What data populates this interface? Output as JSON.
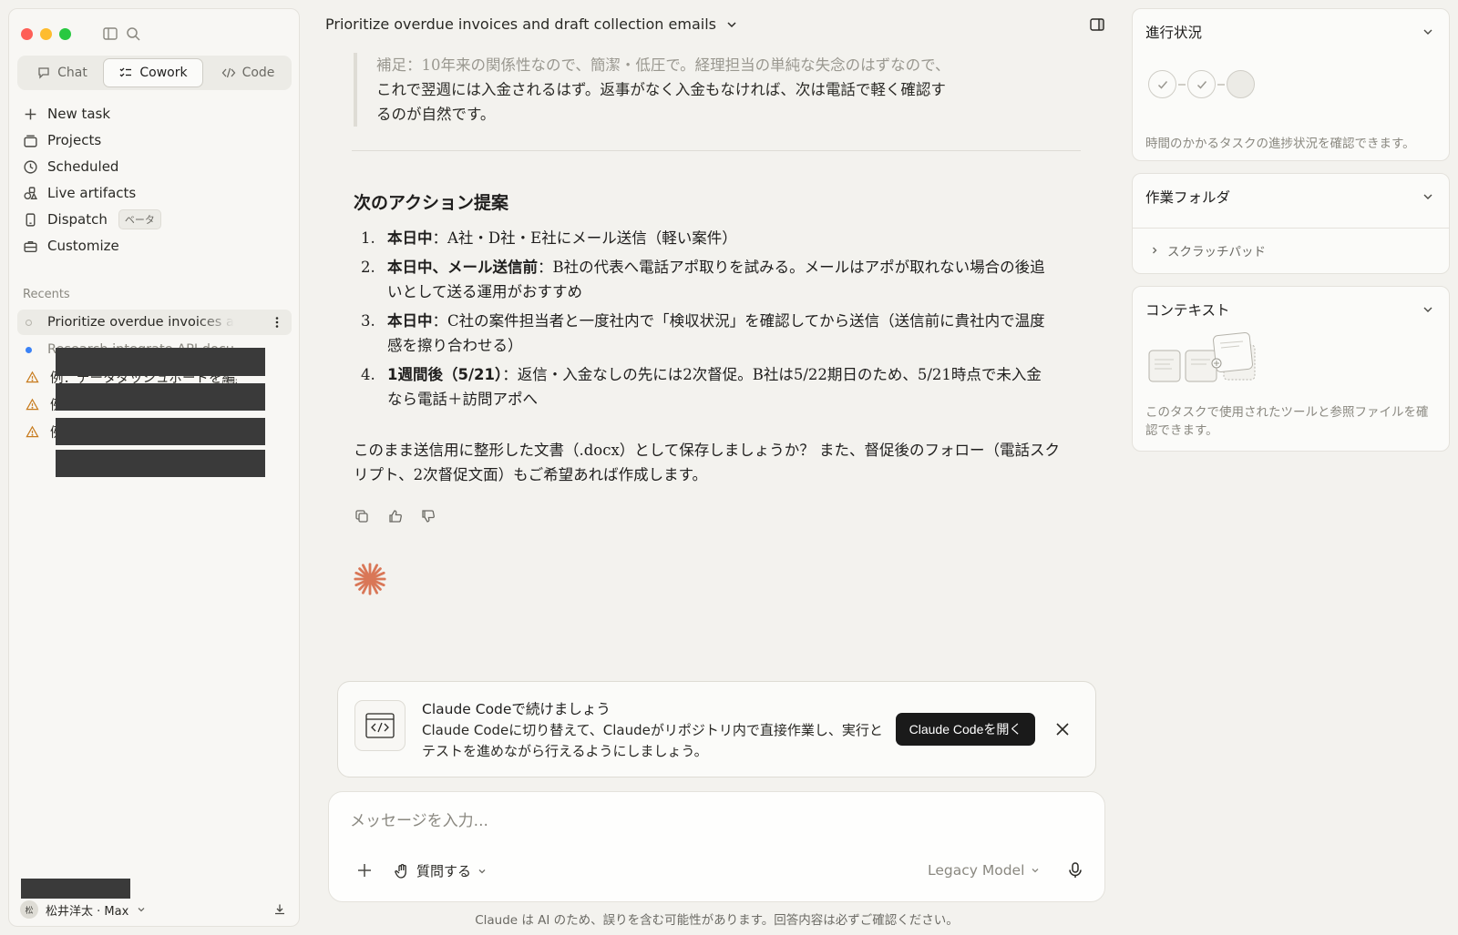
{
  "sidebar": {
    "modes": [
      {
        "label": "Chat",
        "icon": "chat-bubble-icon",
        "active": false
      },
      {
        "label": "Cowork",
        "icon": "checklist-icon",
        "active": true
      },
      {
        "label": "Code",
        "icon": "code-brackets-icon",
        "active": false
      }
    ],
    "nav": {
      "new_task": "New task",
      "projects": "Projects",
      "scheduled": "Scheduled",
      "live_artifacts": "Live artifacts",
      "dispatch": "Dispatch",
      "dispatch_badge": "ベータ",
      "customize": "Customize"
    },
    "recents_label": "Recents",
    "recents": [
      {
        "title": "Prioritize overdue invoices and draft collection emails",
        "status": "active"
      },
      {
        "title": "Research integrate API documentation",
        "status": "blue-dot"
      },
      {
        "title": "例：データダッシュボードを編集",
        "status": "warning"
      },
      {
        "title": "例：",
        "status": "warning"
      },
      {
        "title": "例：",
        "status": "warning"
      }
    ],
    "user": {
      "avatar_initial": "松",
      "name": "松井洋太 · Max"
    }
  },
  "header": {
    "title": "Prioritize overdue invoices and draft collection emails"
  },
  "message": {
    "quote_line1": "補足：10年来の関係性なので、簡潔・低圧で。経理担当の単純な失念のはずなので、",
    "quote_line2": "これで翌週には入金されるはず。返事がなく入金もなければ、次は電話で軽く確認す",
    "quote_line3": "るのが自然です。",
    "heading": "次のアクション提案",
    "actions": [
      {
        "num": "1.",
        "bold": "本日中",
        "text": "：A社・D社・E社にメール送信（軽い案件）"
      },
      {
        "num": "2.",
        "bold": "本日中、メール送信前",
        "text": "：B社の代表へ電話アポ取りを試みる。メールはアポが取れない場合の後追いとして送る運用がおすすめ"
      },
      {
        "num": "3.",
        "bold": "本日中",
        "text": "：C社の案件担当者と一度社内で「検収状況」を確認してから送信（送信前に貴社内で温度感を擦り合わせる）"
      },
      {
        "num": "4.",
        "bold": "1週間後（5/21）",
        "text": "：返信・入金なしの先には2次督促。B社は5/22期日のため、5/21時点で未入金なら電話＋訪問アポへ"
      }
    ],
    "closing": "このまま送信用に整形した文書（.docx）として保存しましょうか？ また、督促後のフォロー（電話スクリプト、2次督促文面）もご希望あれば作成します。"
  },
  "promo": {
    "title": "Claude Codeで続けましょう",
    "body": "Claude Codeに切り替えて、Claudeがリポジトリ内で直接作業し、実行とテストを進めながら行えるようにしましょう。",
    "button": "Claude Codeを開く"
  },
  "composer": {
    "placeholder": "メッセージを入力...",
    "ask_label": "質問する",
    "model_label": "Legacy Model"
  },
  "footer_note": "Claude は AI のため、誤りを含む可能性があります。回答内容は必ずご確認ください。",
  "right_panel": {
    "progress": {
      "title": "進行状況",
      "desc": "時間のかかるタスクの進捗状況を確認できます。"
    },
    "folder": {
      "title": "作業フォルダ",
      "item": "スクラッチパッド"
    },
    "context": {
      "title": "コンテキスト",
      "desc": "このタスクで使用されたツールと参照ファイルを確認できます。"
    }
  },
  "colors": {
    "accent_spark": "#d97757",
    "button_dark": "#1a1a1a",
    "background": "#f3f2ee"
  }
}
